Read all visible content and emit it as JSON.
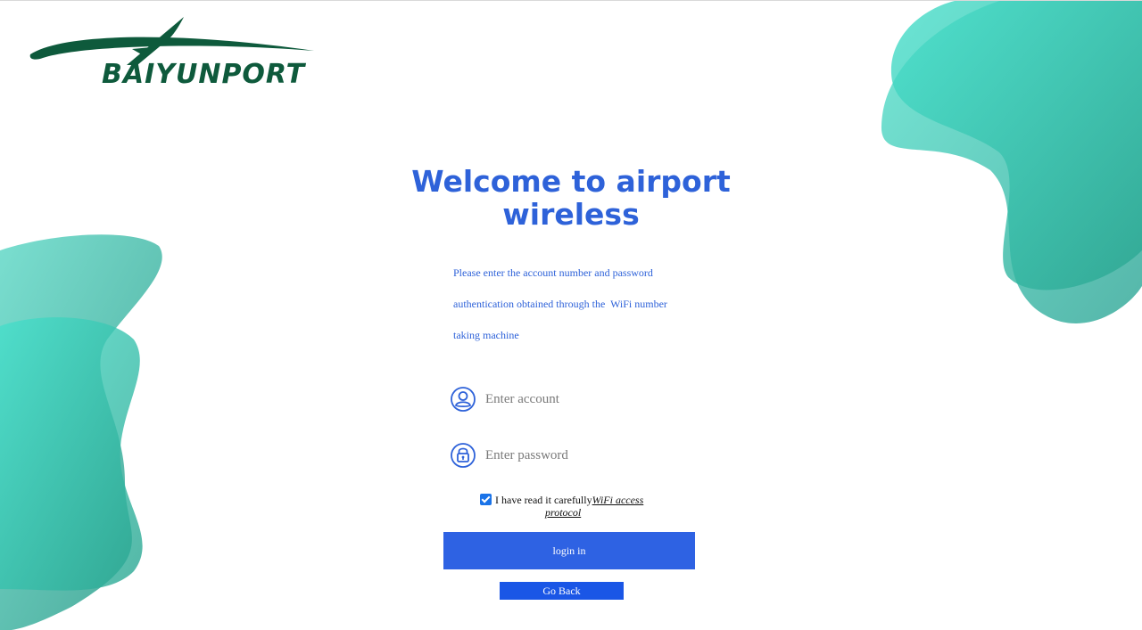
{
  "brand": {
    "logo_text": "BAIYUNPORT",
    "logo_color": "#0e5a3c"
  },
  "title": {
    "line1": "Welcome to airport",
    "line2": "wireless"
  },
  "instructions": {
    "line1": "Please enter the account number and password",
    "line2": "authentication obtained through the  WiFi number",
    "line3": "taking machine"
  },
  "form": {
    "account_placeholder": "Enter account",
    "account_value": "",
    "account_icon": "user-icon",
    "password_placeholder": "Enter password",
    "password_value": "",
    "password_icon": "lock-icon"
  },
  "agreement": {
    "checked": true,
    "text": "I have read it carefully",
    "link_part1": "WiFi access",
    "link_part2": "protocol"
  },
  "buttons": {
    "login_label": "login in",
    "back_label": "Go Back"
  },
  "colors": {
    "accent": "#2e62d9",
    "button": "#2e62e3",
    "back_button": "#1a56e6",
    "blob_teal": "#3ccfb8"
  }
}
